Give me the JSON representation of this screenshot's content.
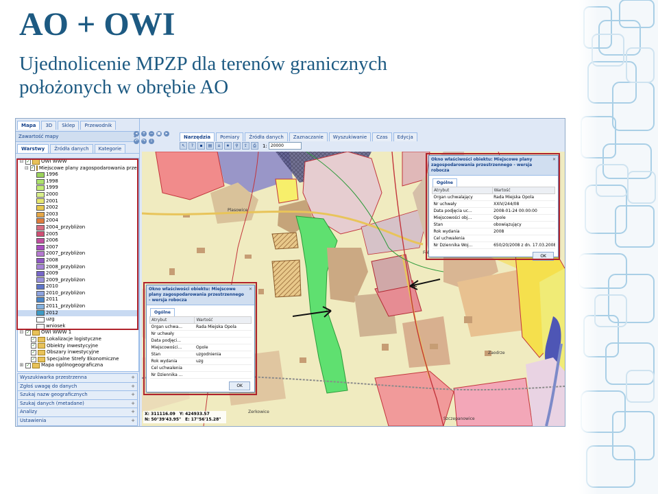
{
  "slide": {
    "title": "AO + OWI",
    "subtitle_line1": "Ujednolicenie MPZP dla terenów granicznych",
    "subtitle_line2": "położonych w obrębie AO"
  },
  "app": {
    "top_tabs": [
      "Mapa",
      "3D",
      "Sklep",
      "Przewodnik"
    ],
    "panel_title": "Zawartość mapy",
    "sec_tabs": [
      "Warstwy",
      "Źródła danych",
      "Kategorie"
    ],
    "tree": [
      {
        "label": "OWI WWW",
        "level": 0,
        "exp": "⊟",
        "check": true,
        "folder": true
      },
      {
        "label": "Miejscowe plany zagospodarowania przestrzennego",
        "level": 1,
        "exp": "⊟",
        "check": true,
        "folder": true
      },
      {
        "label": "1996",
        "level": 2,
        "swatch": "#9cd35c"
      },
      {
        "label": "1998",
        "level": 2,
        "swatch": "#aee36d"
      },
      {
        "label": "1999",
        "level": 2,
        "swatch": "#c4ec75"
      },
      {
        "label": "2000",
        "level": 2,
        "swatch": "#d9f08b"
      },
      {
        "label": "2001",
        "level": 2,
        "swatch": "#e8e86f"
      },
      {
        "label": "2002",
        "level": 2,
        "swatch": "#e7c84e"
      },
      {
        "label": "2003",
        "level": 2,
        "swatch": "#e5a747"
      },
      {
        "label": "2004",
        "level": 2,
        "swatch": "#e07d3d"
      },
      {
        "label": "2004_przybliżon",
        "level": 2,
        "swatch": "#d66d82"
      },
      {
        "label": "2005",
        "level": 2,
        "swatch": "#cf4f74"
      },
      {
        "label": "2006",
        "level": 2,
        "swatch": "#c14fa0"
      },
      {
        "label": "2007",
        "level": 2,
        "swatch": "#a94ec0"
      },
      {
        "label": "2007_przybliżon",
        "level": 2,
        "swatch": "#b679d1"
      },
      {
        "label": "2008",
        "level": 2,
        "swatch": "#9058c4"
      },
      {
        "label": "2008_przybliżon",
        "level": 2,
        "swatch": "#a684d6"
      },
      {
        "label": "2009",
        "level": 2,
        "swatch": "#7867c9"
      },
      {
        "label": "2009_przybliżon",
        "level": 2,
        "swatch": "#9b92dc"
      },
      {
        "label": "2010",
        "level": 2,
        "swatch": "#5e75c9"
      },
      {
        "label": "2010_przybliżon",
        "level": 2,
        "swatch": "#8ea3df"
      },
      {
        "label": "2011",
        "level": 2,
        "swatch": "#4a86c8"
      },
      {
        "label": "2011_przybliżon",
        "level": 2,
        "swatch": "#84b2e0"
      },
      {
        "label": "2012",
        "level": 2,
        "swatch": "#3d9bc6",
        "selected": true
      },
      {
        "label": "uzg",
        "level": 2,
        "swatch": "#ffffff"
      },
      {
        "label": "wniosek",
        "level": 2,
        "swatch": "#f4f4f4"
      },
      {
        "label": "OWI WWW 1",
        "level": 0,
        "exp": "⊟",
        "check": true,
        "folder": true
      },
      {
        "label": "Lokalizacje logistyczne",
        "level": 1,
        "check": true,
        "folder": true
      },
      {
        "label": "Obiekty inwestycyjne",
        "level": 1,
        "check": true,
        "folder": true
      },
      {
        "label": "Obszary inwestycyjne",
        "level": 1,
        "check": true,
        "folder": true
      },
      {
        "label": "Specjalne Strefy Ekonomiczne",
        "level": 1,
        "check": true,
        "folder": true
      },
      {
        "label": "Mapa ogólnogeograficzna",
        "level": 0,
        "exp": "⊞",
        "check": true,
        "folder": true
      }
    ],
    "accordion": [
      "Wyszukiwarka przestrzenna",
      "Zgłoś uwagę do danych",
      "Szukaj nazw geograficznych",
      "Szukaj danych (metadane)",
      "Analizy",
      "Ustawienia"
    ],
    "toolbar_tabs": [
      "Narzędzia",
      "Pomiary",
      "Źródła danych",
      "Zaznaczanie",
      "Wyszukiwanie",
      "Czas",
      "Edycja"
    ],
    "scale_label": "1:",
    "scale_value": "20000",
    "coords": {
      "x": "X: 311116.09",
      "y": "Y: 424933.57",
      "n": "N: 50°39'43.95\"",
      "e": "E: 17°56'15.28\""
    },
    "map_labels": [
      "Plasowice",
      "Folwieś",
      "Zaodrze",
      "Szczepanowice",
      "Zerkowice"
    ]
  },
  "popup_right": {
    "title": "Okno właściwości obiektu: Miejscowe plany zagospodarowania przestrzennego - wersja robocza",
    "tab": "Ogólne",
    "col_attr": "Atrybut",
    "col_val": "Wartość",
    "rows": [
      [
        "Organ uchwalający",
        "Rada Miejska Opola"
      ],
      [
        "Nr uchwały",
        "XXIV/244/08"
      ],
      [
        "Data podjęcia uc...",
        "2008-01-24 00:00:00"
      ],
      [
        "Miejscowości obj...",
        "Opole"
      ],
      [
        "Stan",
        "obowiązujący"
      ],
      [
        "Rok wydania",
        "2008"
      ],
      [
        "Cel uchwalenia",
        ""
      ],
      [
        "Nr Dziennika Woj...",
        "650/20/2008 z dn. 17.03.2008"
      ]
    ],
    "ok": "OK"
  },
  "popup_left": {
    "title": "Okno właściwości obiektu: Miejscowe plany zagospodarowania przestrzennego - wersja robocza",
    "tab": "Ogólne",
    "col_attr": "Atrybut",
    "col_val": "Wartość",
    "rows": [
      [
        "Organ uchwa...",
        "Rada Miejska Opola"
      ],
      [
        "Nr uchwały",
        ""
      ],
      [
        "Data podjęci...",
        ""
      ],
      [
        "Miejscowości...",
        "Opole"
      ],
      [
        "Stan",
        "uzgodnienia"
      ],
      [
        "Rok wydania",
        "uzg"
      ],
      [
        "Cel uchwalenia",
        ""
      ],
      [
        "Nr Dziennika ...",
        ""
      ]
    ],
    "ok": "OK"
  }
}
